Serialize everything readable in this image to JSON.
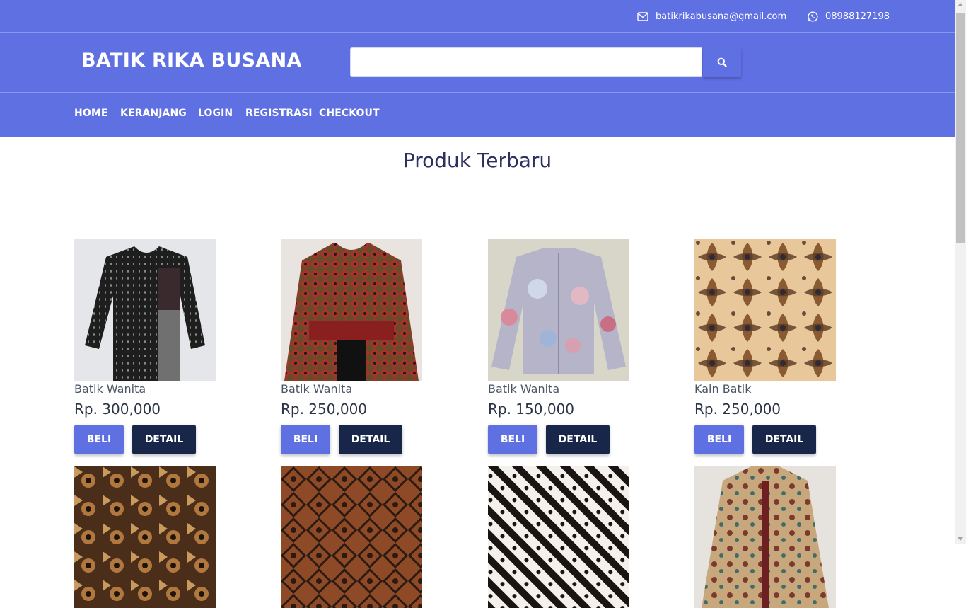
{
  "topbar": {
    "email": "batikrikabusana@gmail.com",
    "phone": "08988127198"
  },
  "header": {
    "brand": "BATIK RIKA BUSANA",
    "search_placeholder": ""
  },
  "nav": {
    "items": [
      "HOME",
      "KERANJANG",
      "LOGIN",
      "REGISTRASI",
      "CHECKOUT"
    ]
  },
  "section_title": "Produk Terbaru",
  "buttons": {
    "buy": "BELI",
    "detail": "DETAIL"
  },
  "products": [
    {
      "name": "Batik Wanita",
      "price": "Rp. 300,000",
      "image": "black-batik-blouse"
    },
    {
      "name": "Batik Wanita",
      "price": "Rp. 250,000",
      "image": "red-batik-dress"
    },
    {
      "name": "Batik Wanita",
      "price": "Rp. 150,000",
      "image": "pastel-floral-batik-jacket"
    },
    {
      "name": "Kain Batik",
      "price": "Rp. 250,000",
      "image": "brown-batik-fabric"
    },
    {
      "name": "",
      "price": "",
      "image": "dark-brown-batik-fabric"
    },
    {
      "name": "",
      "price": "",
      "image": "sogan-batik-fabric"
    },
    {
      "name": "",
      "price": "",
      "image": "parang-batik-fabric"
    },
    {
      "name": "",
      "price": "",
      "image": "batik-shirt"
    }
  ],
  "colors": {
    "primary": "#5f70e3",
    "dark_button": "#172649",
    "white": "#ffffff"
  }
}
